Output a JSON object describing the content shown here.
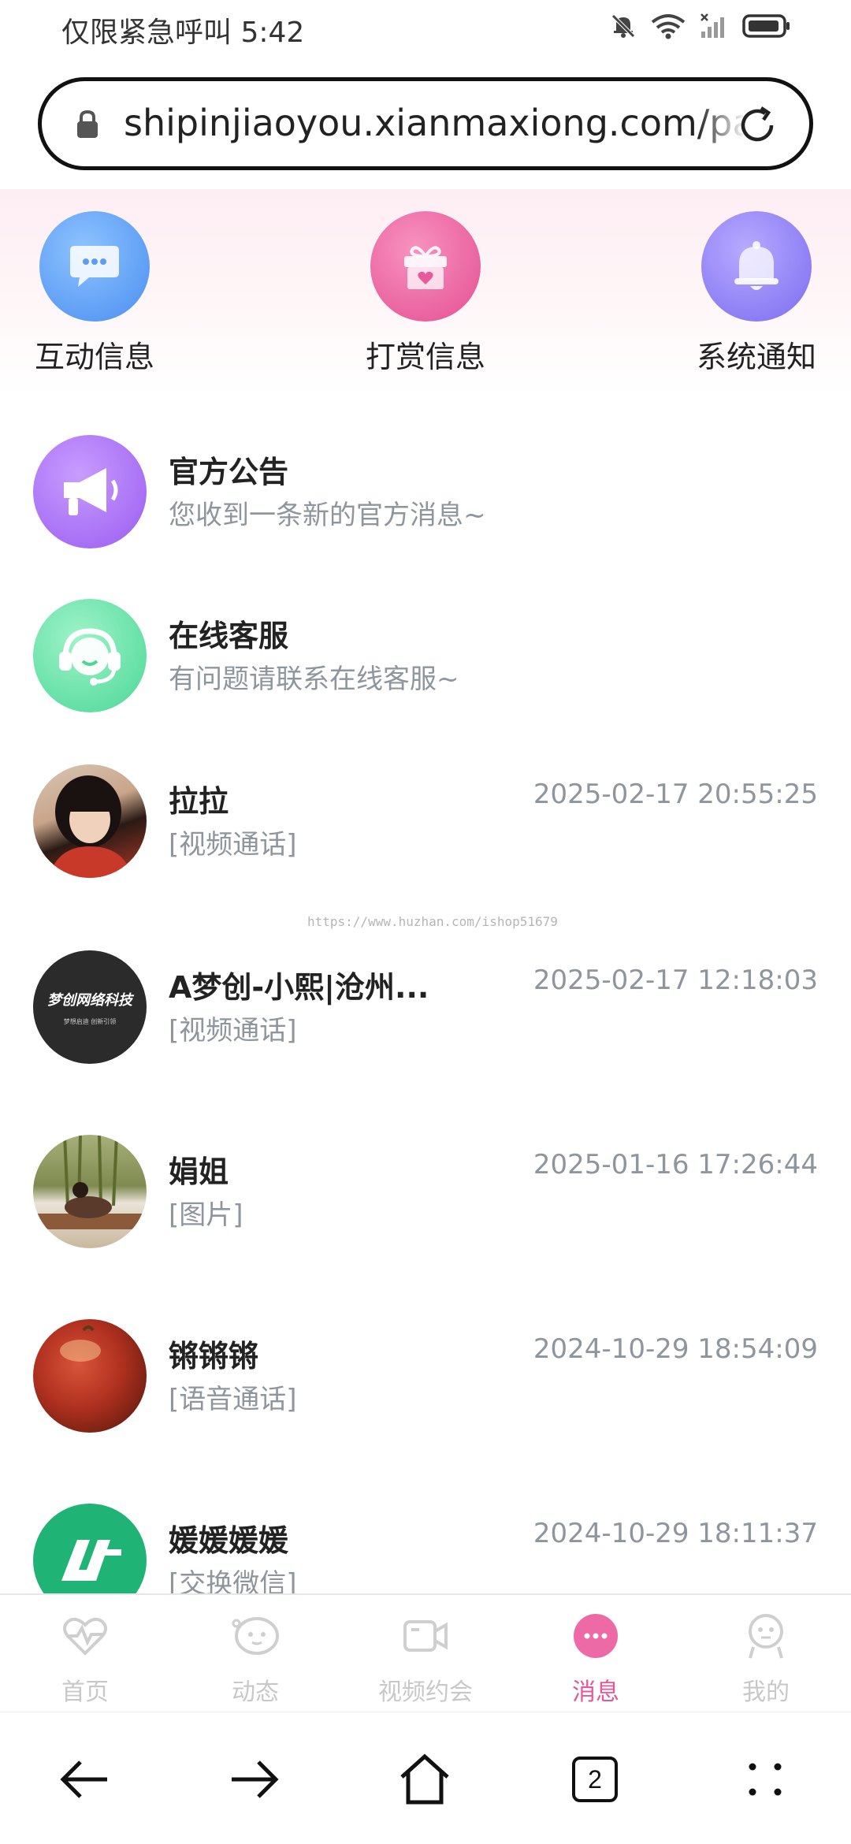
{
  "status_bar": {
    "text": "仅限紧急呼叫 5:42"
  },
  "url_bar": {
    "url": "shipinjiaoyou.xianmaxiong.com/pages"
  },
  "quick_actions": [
    {
      "label": "互动信息",
      "icon": "chat-bubble-icon",
      "color": "#5b9cf5"
    },
    {
      "label": "打赏信息",
      "icon": "gift-icon",
      "color": "#ec5c9d"
    },
    {
      "label": "系统通知",
      "icon": "bell-icon",
      "color": "#8a7cf2"
    }
  ],
  "messages": [
    {
      "name": "官方公告",
      "subtitle": "您收到一条新的官方消息~",
      "time": "",
      "avatar_icon": "megaphone-icon"
    },
    {
      "name": "在线客服",
      "subtitle": "有问题请联系在线客服~",
      "time": "",
      "avatar_icon": "headset-icon"
    },
    {
      "name": "拉拉",
      "subtitle": "[视频通话]",
      "time": "2025-02-17 20:55:25",
      "avatar_icon": "user-photo"
    },
    {
      "name": "A梦创-小熙|沧州...",
      "subtitle": "[视频通话]",
      "time": "2025-02-17 12:18:03",
      "avatar_icon": "company-logo",
      "avatar_text": "梦创网络科技",
      "avatar_small": "梦想启迪  创新引领"
    },
    {
      "name": "娟姐",
      "subtitle": "[图片]",
      "time": "2025-01-16 17:26:44",
      "avatar_icon": "user-photo"
    },
    {
      "name": "锵锵锵",
      "subtitle": "[语音通话]",
      "time": "2024-10-29 18:54:09",
      "avatar_icon": "apple-photo"
    },
    {
      "name": "媛媛媛媛",
      "subtitle": "[交换微信]",
      "time": "2024-10-29 18:11:37",
      "avatar_icon": "green-logo"
    }
  ],
  "watermark": "https://www.huzhan.com/ishop51679",
  "tabs": [
    {
      "label": "首页",
      "icon": "heartbeat-icon",
      "active": false
    },
    {
      "label": "动态",
      "icon": "face-bubble-icon",
      "active": false
    },
    {
      "label": "视频约会",
      "icon": "video-camera-icon",
      "active": false
    },
    {
      "label": "消息",
      "icon": "message-icon",
      "active": true
    },
    {
      "label": "我的",
      "icon": "profile-icon",
      "active": false
    }
  ],
  "browser_nav": {
    "tab_count": "2"
  },
  "colors": {
    "accent": "#e8569a",
    "muted_text": "#8e959c"
  }
}
